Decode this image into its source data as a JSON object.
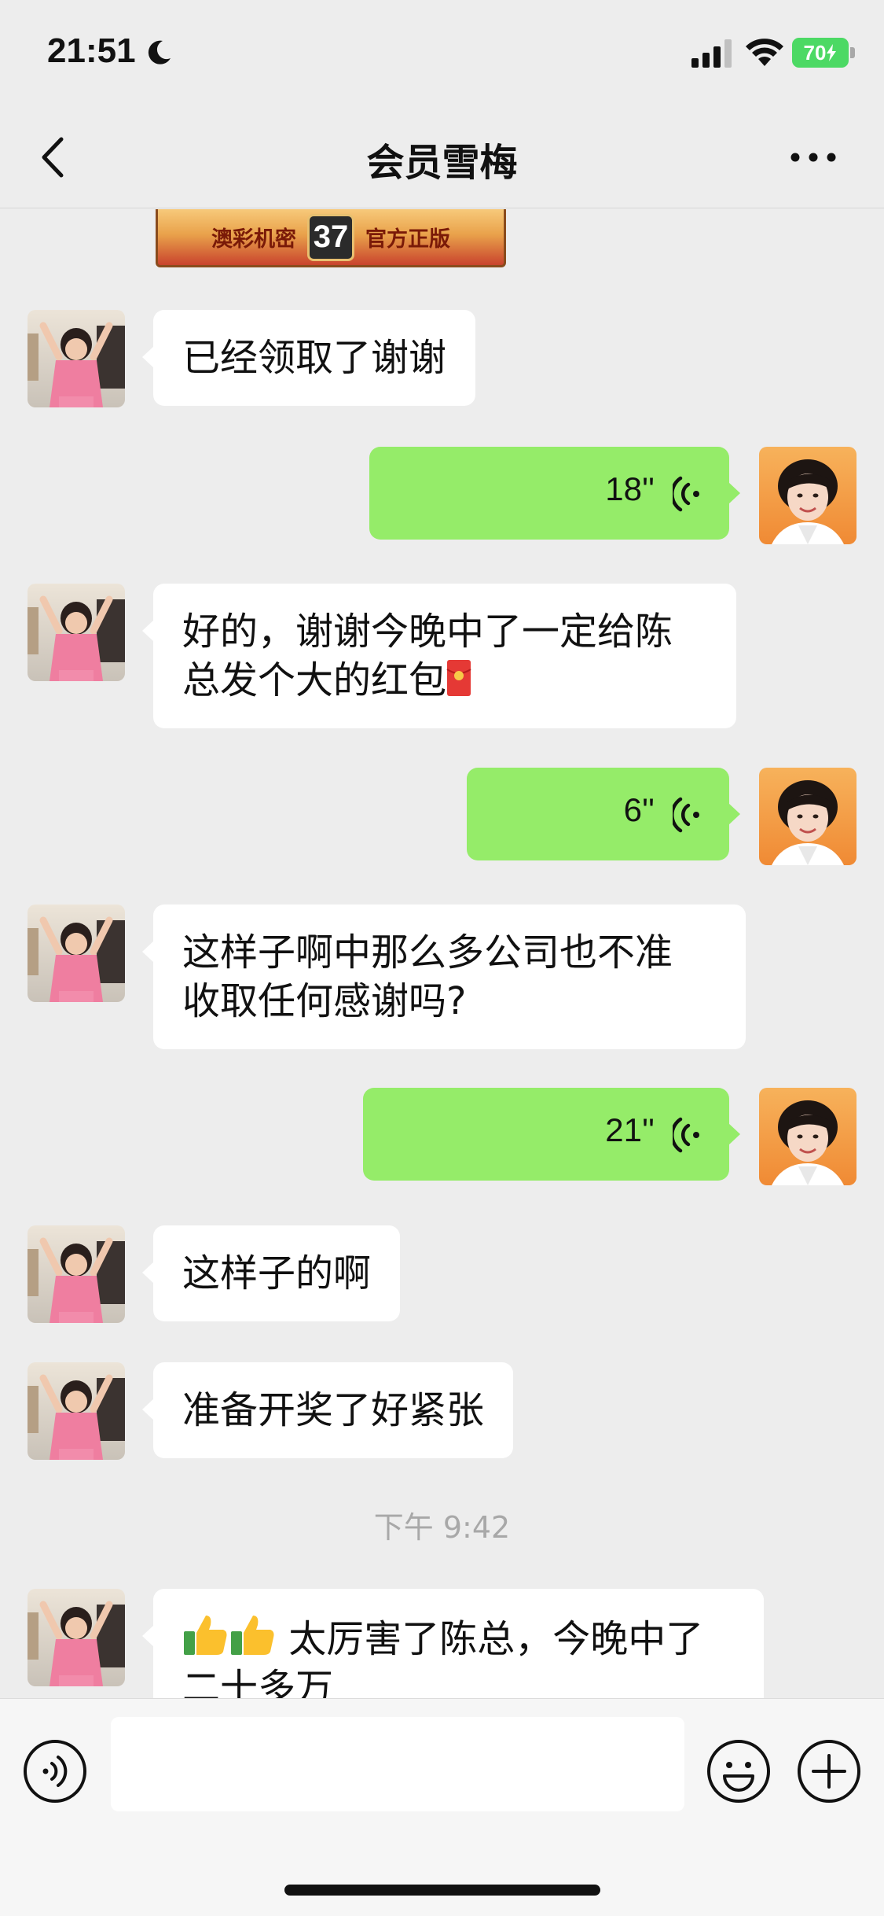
{
  "status_bar": {
    "time": "21:51",
    "battery": "70"
  },
  "nav": {
    "title": "会员雪梅"
  },
  "banner": {
    "left_text": "澳彩机密",
    "number": "37",
    "right_text": "官方正版"
  },
  "messages": [
    {
      "side": "left",
      "type": "text",
      "text": "已经领取了谢谢"
    },
    {
      "side": "right",
      "type": "voice",
      "duration": "18''"
    },
    {
      "side": "left",
      "type": "text",
      "lines": [
        "好的，谢谢今晚中了一定给陈",
        "总发个大的红包"
      ],
      "trailing_emoji": "red-envelope"
    },
    {
      "side": "right",
      "type": "voice",
      "duration": "6''"
    },
    {
      "side": "left",
      "type": "text",
      "lines": [
        "这样子啊中那么多公司也不准",
        "收取任何感谢吗?"
      ]
    },
    {
      "side": "right",
      "type": "voice",
      "duration": "21''"
    },
    {
      "side": "left",
      "type": "text",
      "text": "这样子的啊"
    },
    {
      "side": "left",
      "type": "text",
      "text": "准备开奖了好紧张"
    },
    {
      "type": "timestamp",
      "text": "下午 9:42"
    },
    {
      "side": "left",
      "type": "text",
      "leading_emoji": [
        "thumbs-up",
        "thumbs-up"
      ],
      "lines": [
        " 太厉害了陈总，今晚中了",
        "二十多万"
      ]
    }
  ],
  "colors": {
    "background": "#ededed",
    "outgoing_bubble": "#95ec69",
    "incoming_bubble": "#ffffff",
    "timestamp": "#a8a8a8"
  },
  "icons": {
    "back": "chevron-left-icon",
    "more": "ellipsis-icon",
    "voice_toggle": "voice-toggle-icon",
    "emoji": "smiley-icon",
    "plus": "plus-icon"
  }
}
